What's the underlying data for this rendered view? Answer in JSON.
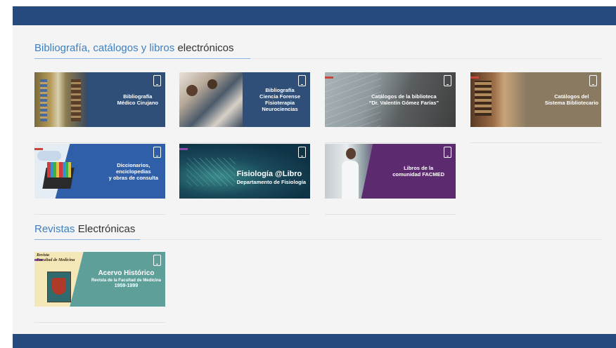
{
  "sections": [
    {
      "title_highlight": "Bibliografía, catálogos y libros",
      "title_rest": " electrónicos",
      "cards": [
        {
          "lines": [
            "Bibliografía",
            "Médico Cirujano"
          ]
        },
        {
          "lines": [
            "Bibliografía",
            "Ciencia Forense",
            "Fisioterapia",
            "Neurociencias"
          ]
        },
        {
          "lines": [
            "Catálogos de la biblioteca",
            "\"Dr. Valentín Gómez Farías\""
          ]
        },
        {
          "lines": [
            "Catálogos del",
            "Sistema Bibliotecario"
          ]
        },
        {
          "lines": [
            "Diccionarios,",
            "enciclopedias",
            "y obras de consulta"
          ]
        },
        {
          "lines": [
            "Fisiología @Libro",
            "Departamento de Fisiología"
          ]
        },
        {
          "lines": [
            "Libros de la",
            "comunidad FACMED"
          ]
        }
      ]
    },
    {
      "title_highlight": "Revistas",
      "title_rest": " Electrónicas",
      "cards": [
        {
          "lines": [
            "Acervo Histórico",
            "Revista de la Facultad de Medicina",
            "1959-1999"
          ],
          "corner": [
            "Revista",
            "Facultad de Medicina"
          ]
        }
      ]
    }
  ],
  "icons": {
    "card_device": "tablet-icon"
  },
  "colors": {
    "header_blue": "#264a7e",
    "accent_blue": "#3d80c4",
    "card_bibliografia": "#2f4f78",
    "card_forense": "#2f4f78",
    "card_catalogos_biblioteca": "#4a4a4a",
    "card_catalogos_sistema": "#8a7a62",
    "card_diccionarios": "#2f5fa8",
    "card_fisiologia": "#0f3346",
    "card_libros": "#5c2a6e",
    "card_revista": "#5f9f9a"
  }
}
